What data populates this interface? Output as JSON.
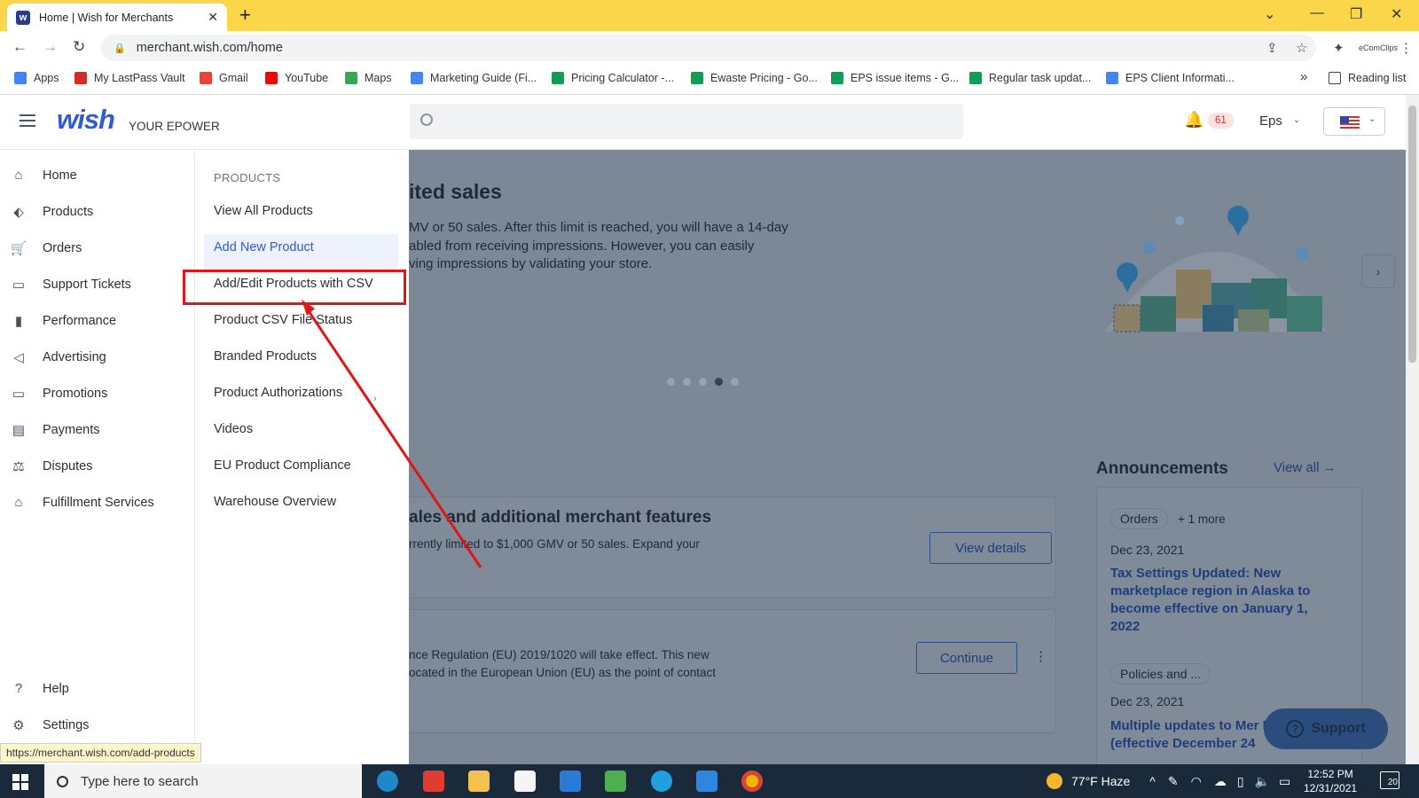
{
  "browser": {
    "tab_title": "Home | Wish for Merchants",
    "favicon_letter": "w",
    "url": "merchant.wish.com/home",
    "status_url": "https://merchant.wish.com/add-products"
  },
  "bookmarks": [
    {
      "label": "Apps",
      "color": "#4285f4"
    },
    {
      "label": "My LastPass Vault",
      "color": "#d32d27"
    },
    {
      "label": "Gmail",
      "color": "#ea4335"
    },
    {
      "label": "YouTube",
      "color": "#ff0000"
    },
    {
      "label": "Maps",
      "color": "#34a853"
    },
    {
      "label": "Marketing Guide (Fi...",
      "color": "#4285f4"
    },
    {
      "label": "Pricing Calculator -...",
      "color": "#0f9d58"
    },
    {
      "label": "Ewaste Pricing - Go...",
      "color": "#0f9d58"
    },
    {
      "label": "EPS issue items - G...",
      "color": "#0f9d58"
    },
    {
      "label": "Regular task updat...",
      "color": "#0f9d58"
    },
    {
      "label": "EPS Client Informati...",
      "color": "#4285f4"
    }
  ],
  "bookmarks_more": "»",
  "reading_list": "Reading list",
  "header": {
    "logo": "wish",
    "tagline": "YOUR EPOWER",
    "notification_count": "61",
    "user": "Eps"
  },
  "leftnav": {
    "items": [
      {
        "label": "Home",
        "icon": "⌂"
      },
      {
        "label": "Products",
        "icon": "⬖"
      },
      {
        "label": "Orders",
        "icon": "🛒"
      },
      {
        "label": "Support Tickets",
        "icon": "▭"
      },
      {
        "label": "Performance",
        "icon": "▮"
      },
      {
        "label": "Advertising",
        "icon": "◁"
      },
      {
        "label": "Promotions",
        "icon": "▭"
      },
      {
        "label": "Payments",
        "icon": "▤"
      },
      {
        "label": "Disputes",
        "icon": "⚖"
      },
      {
        "label": "Fulfillment Services",
        "icon": "⌂"
      }
    ],
    "help": "Help",
    "settings": "Settings"
  },
  "submenu": {
    "heading": "PRODUCTS",
    "items": [
      "View All Products",
      "Add New Product",
      "Add/Edit Products with CSV",
      "Product CSV File Status",
      "Branded Products",
      "Product Authorizations",
      "Videos",
      "EU Product Compliance",
      "Warehouse Overview"
    ]
  },
  "main": {
    "banner_title": "ited sales",
    "banner_line1": "MV or 50 sales. After this limit is reached, you will have a 14-day",
    "banner_line2": "abled from receiving impressions. However, you can easily",
    "banner_line3": "ving impressions by validating your store.",
    "card1_title": "ales and additional merchant features",
    "card1_text": "rrently limited to $1,000 GMV or 50 sales. Expand your",
    "card1_button": "View details",
    "card2_line1": "nce Regulation (EU) 2019/1020 will take effect. This new",
    "card2_line2": "ocated in the European Union (EU) as the point of contact",
    "card2_button": "Continue",
    "announcements_title": "Announcements",
    "view_all": "View all",
    "ann_tag": "Orders",
    "ann_more": "+ 1 more",
    "ann_date1": "Dec 23, 2021",
    "ann_title1": "Tax Settings Updated: New marketplace region in Alaska to become effective on January 1, 2022",
    "ann_tag2": "Policies and ...",
    "ann_date2": "Dec 23, 2021",
    "ann_title2": "Multiple updates to Mer Policy 13 (effective December 24",
    "support_label": "Support"
  },
  "taskbar": {
    "search_placeholder": "Type here to search",
    "weather": "77°F  Haze",
    "time": "12:52 PM",
    "date": "12/31/2021",
    "notifications": "20"
  }
}
